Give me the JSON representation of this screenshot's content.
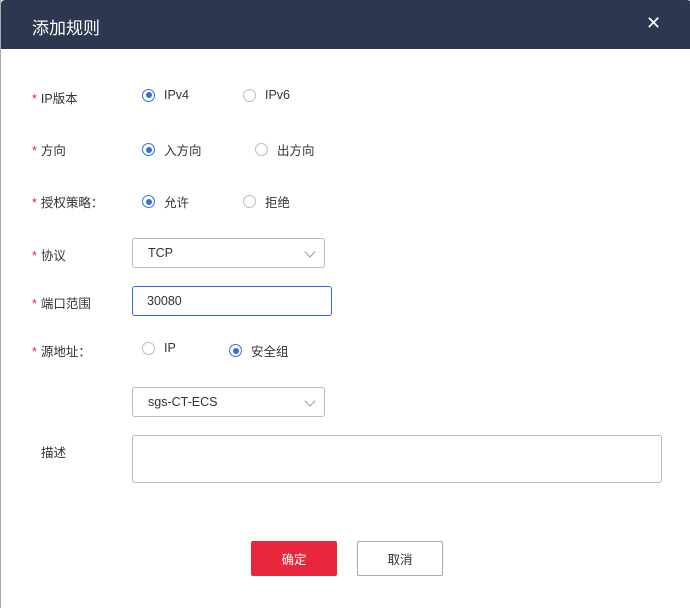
{
  "dialog": {
    "title": "添加规则"
  },
  "fields": {
    "ip_version": {
      "label": "IP版本",
      "options": [
        "IPv4",
        "IPv6"
      ],
      "selected": "IPv4"
    },
    "direction": {
      "label": "方向",
      "options": [
        "入方向",
        "出方向"
      ],
      "selected": "入方向"
    },
    "policy": {
      "label": "授权策略：",
      "options": [
        "允许",
        "拒绝"
      ],
      "selected": "允许"
    },
    "protocol": {
      "label": "协议",
      "value": "TCP"
    },
    "port": {
      "label": "端口范围",
      "value": "30080"
    },
    "source": {
      "label": "源地址：",
      "options": [
        "IP",
        "安全组"
      ],
      "selected": "安全组"
    },
    "security_group": {
      "value": "sgs-CT-ECS"
    },
    "description": {
      "label": "描述",
      "value": ""
    }
  },
  "buttons": {
    "confirm": "确定",
    "cancel": "取消"
  },
  "colors": {
    "header": "#2e3750",
    "primary": "#e8263c",
    "radio": "#2f6fe6"
  }
}
